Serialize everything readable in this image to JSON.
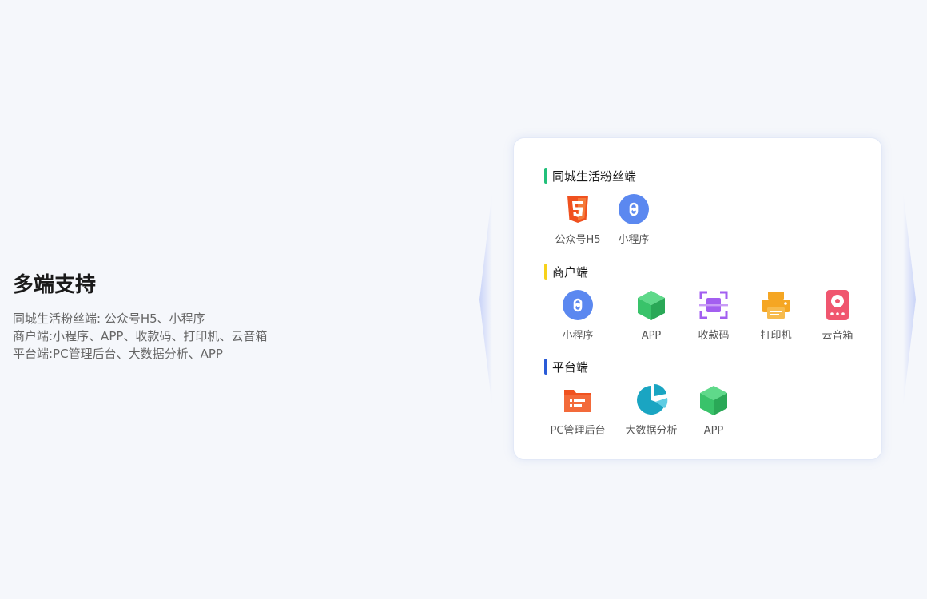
{
  "intro": {
    "title": "多端支持",
    "lines": [
      "同城生活粉丝端: 公众号H5、小程序",
      "商户端:小程序、APP、收款码、打印机、云音箱",
      "平台端:PC管理后台、大数据分析、APP"
    ]
  },
  "sections": [
    {
      "title": "同城生活粉丝端",
      "accent": "#22c07a",
      "items": [
        {
          "label": "公众号H5",
          "icon": "html5-icon",
          "color": "#f0511f"
        },
        {
          "label": "小程序",
          "icon": "mini-program-icon",
          "color": "#5b88f0"
        }
      ]
    },
    {
      "title": "商户端",
      "accent": "#f7d21b",
      "items": [
        {
          "label": "小程序",
          "icon": "mini-program-icon",
          "color": "#5b88f0"
        },
        {
          "label": "APP",
          "icon": "cube-icon",
          "color": "#39c36a"
        },
        {
          "label": "收款码",
          "icon": "scan-code-icon",
          "color": "#a35ff0"
        },
        {
          "label": "打印机",
          "icon": "printer-icon",
          "color": "#f5a623"
        },
        {
          "label": "云音箱",
          "icon": "speaker-icon",
          "color": "#f0566f"
        }
      ]
    },
    {
      "title": "平台端",
      "accent": "#2a5bd7",
      "items": [
        {
          "label": "PC管理后台",
          "icon": "folder-icon",
          "color": "#f0511f"
        },
        {
          "label": "大数据分析",
          "icon": "pie-chart-icon",
          "color": "#1aa5c2"
        },
        {
          "label": "APP",
          "icon": "cube-icon",
          "color": "#39c36a"
        }
      ]
    }
  ]
}
